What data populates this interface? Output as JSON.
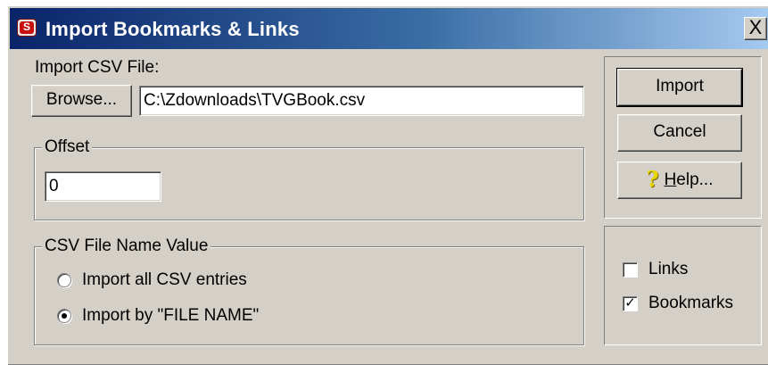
{
  "window": {
    "title": "Import Bookmarks & Links",
    "close_glyph": "X"
  },
  "import_csv": {
    "label": "Import CSV File:",
    "browse_label": "Browse...",
    "file_path": "C:\\Zdownloads\\TVGBook.csv"
  },
  "offset": {
    "group_label": "Offset",
    "value": "0"
  },
  "csv_name": {
    "group_label": "CSV File Name Value",
    "options": [
      {
        "label": "Import all CSV entries",
        "selected": false
      },
      {
        "label": "Import by \"FILE NAME\"",
        "selected": true
      }
    ]
  },
  "actions": {
    "import_label": "Import",
    "cancel_label": "Cancel",
    "help_first": "H",
    "help_rest": "elp..."
  },
  "types": {
    "links": {
      "label": "Links",
      "checked": false
    },
    "bookmarks": {
      "label": "Bookmarks",
      "checked": true
    }
  }
}
